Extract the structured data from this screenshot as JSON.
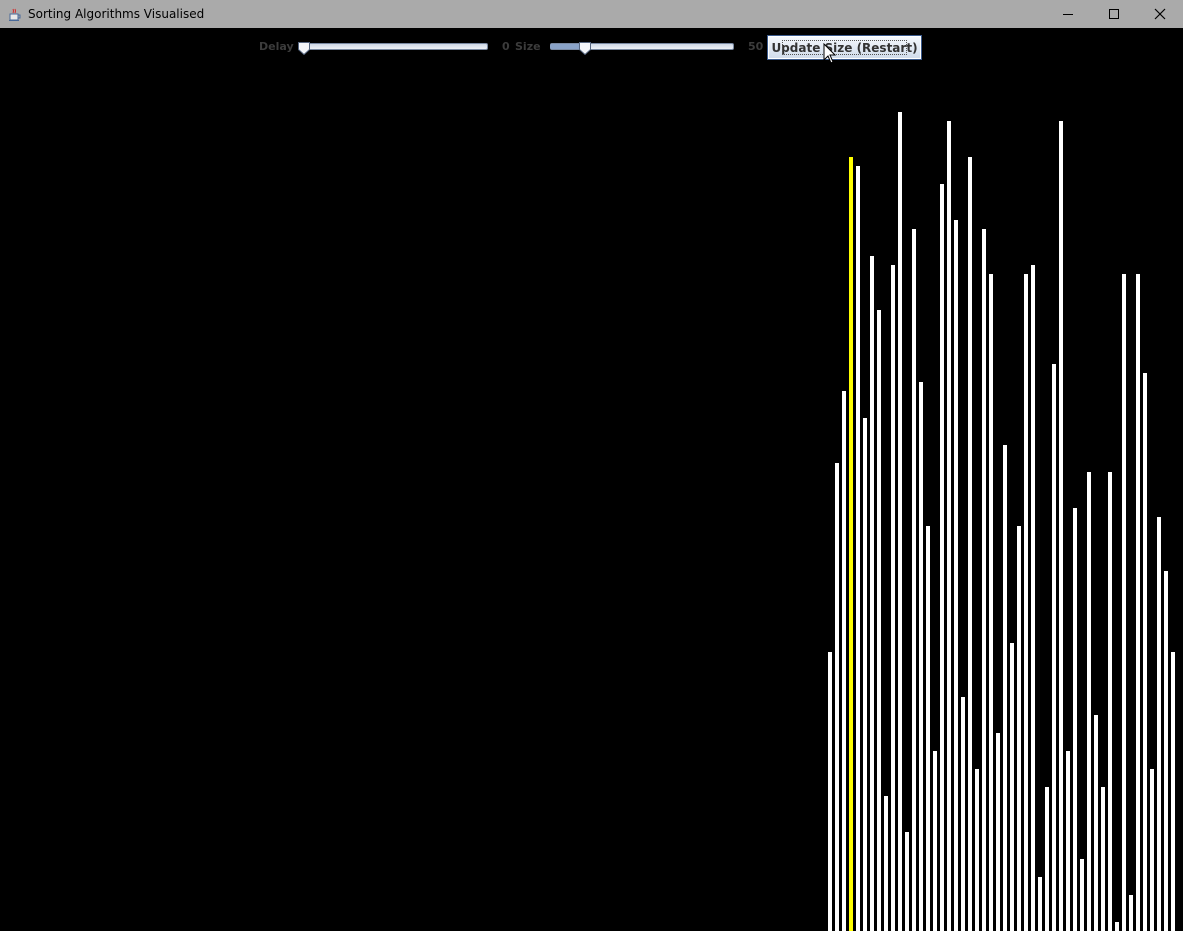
{
  "window": {
    "title": "Sorting Algorithms Visualised",
    "app_icon": "java-cup-icon",
    "controls": [
      "minimize-icon",
      "maximize-icon",
      "close-icon"
    ]
  },
  "toolbar": {
    "delay_label": "Delay",
    "delay_value": "0",
    "delay_min": 0,
    "delay_max": 100,
    "delay_thumb_fraction": 0.0,
    "size_label": "Size",
    "size_value": "50",
    "size_thumb_fraction": 0.17,
    "update_button_label": "Update Size (Restart)"
  },
  "colors": {
    "background": "#000000",
    "bar": "#ffffff",
    "highlight": "#ffff00",
    "titlebar": "#aaaaaa"
  },
  "visualiser": {
    "bar_count": 50,
    "highlight_index": 3,
    "values": [
      279,
      468,
      540,
      774,
      765,
      513,
      675,
      621,
      135,
      666,
      819,
      99,
      702,
      549,
      405,
      180,
      747,
      810,
      711,
      234,
      774,
      162,
      702,
      657,
      198,
      486,
      288,
      405,
      657,
      666,
      54,
      144,
      567,
      810,
      180,
      423,
      72,
      459,
      216,
      144,
      459,
      9,
      657,
      36,
      657,
      558,
      162,
      414,
      360,
      279
    ]
  }
}
